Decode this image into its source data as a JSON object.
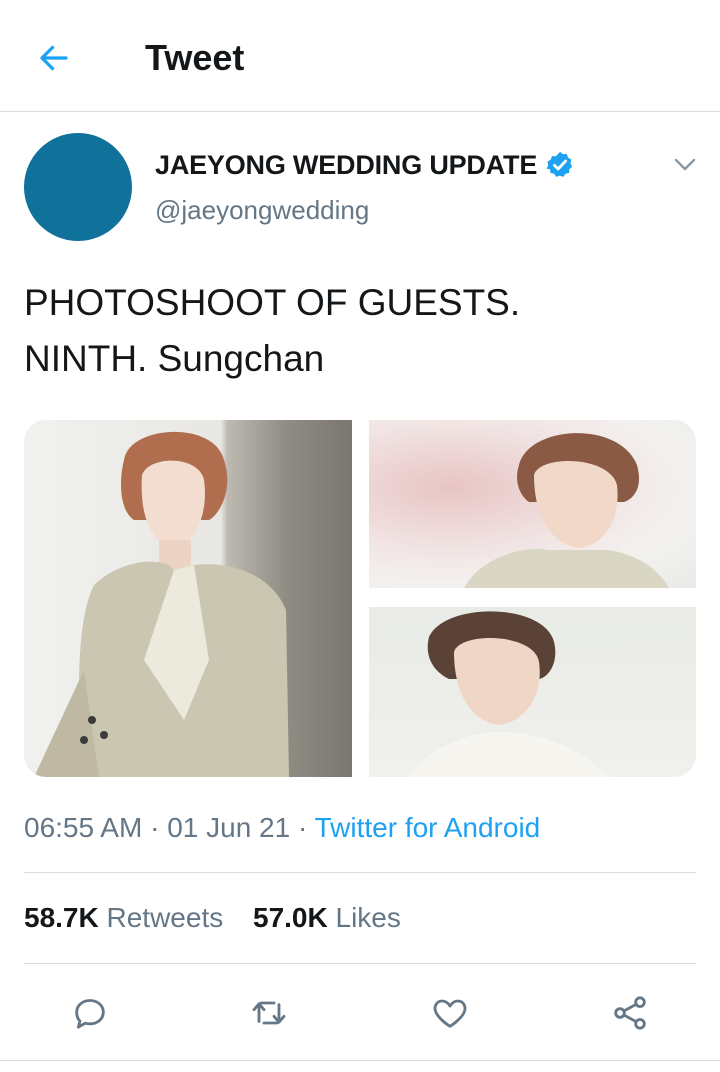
{
  "header": {
    "title": "Tweet",
    "back_icon": "arrow-left-icon",
    "accent": "#1da1f2"
  },
  "tweet": {
    "author": {
      "display_name": "JAEYONG WEDDING UPDATE",
      "handle": "@jaeyongwedding",
      "verified": true,
      "avatar_color": "#10719a"
    },
    "text_line1": "PHOTOSHOOT OF GUESTS.",
    "text_line2": "NINTH. Sungchan",
    "media_count": 3,
    "time": "06:55 AM",
    "separator": "·",
    "date": "01 Jun 21",
    "source": "Twitter for Android",
    "retweets_count": "58.7K",
    "retweets_label": "Retweets",
    "likes_count": "57.0K",
    "likes_label": "Likes"
  },
  "actions": [
    {
      "name": "reply",
      "icon": "reply-icon"
    },
    {
      "name": "retweet",
      "icon": "retweet-icon"
    },
    {
      "name": "like",
      "icon": "heart-icon"
    },
    {
      "name": "share",
      "icon": "share-icon"
    }
  ]
}
